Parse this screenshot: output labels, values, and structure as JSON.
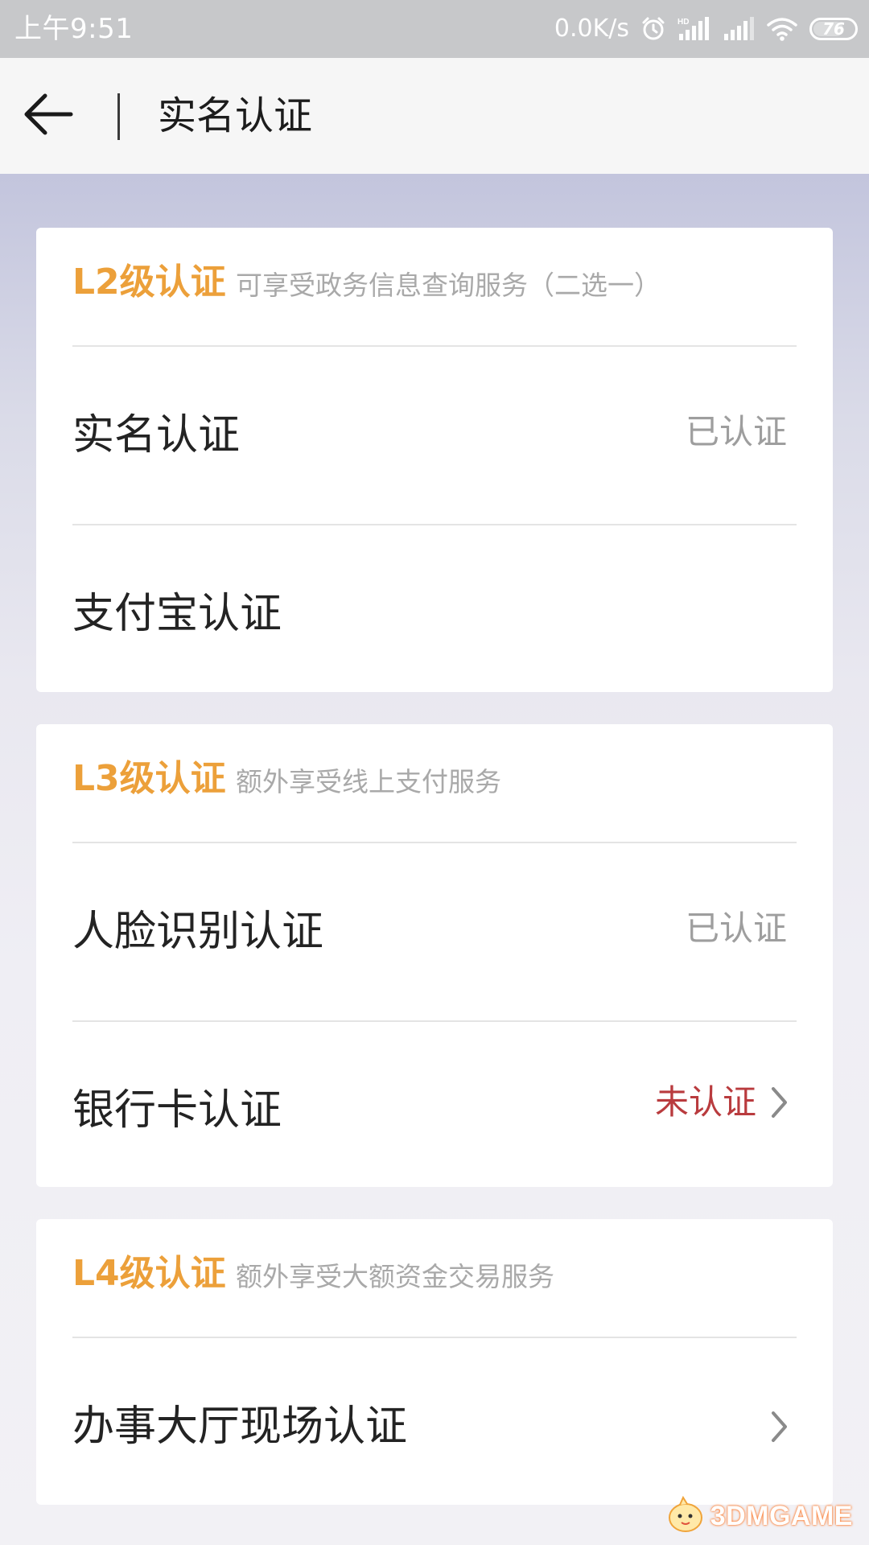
{
  "status_bar": {
    "time": "上午9:51",
    "net_speed": "0.0K/s",
    "battery": "76"
  },
  "app_bar": {
    "title": "实名认证"
  },
  "sections": [
    {
      "level": "L2级认证",
      "desc": "可享受政务信息查询服务（二选一）",
      "items": [
        {
          "label": "实名认证",
          "status": "已认证"
        },
        {
          "label": "支付宝认证",
          "status": ""
        }
      ]
    },
    {
      "level": "L3级认证",
      "desc": "额外享受线上支付服务",
      "items": [
        {
          "label": "人脸识别认证",
          "status": "已认证"
        },
        {
          "label": "银行卡认证",
          "status": "未认证"
        }
      ]
    },
    {
      "level": "L4级认证",
      "desc": "额外享受大额资金交易服务",
      "items": [
        {
          "label": "办事大厅现场认证",
          "status": ""
        }
      ]
    }
  ],
  "watermark": {
    "text": "3DMGAME"
  },
  "colors": {
    "level_accent": "#eca03a",
    "unverified": "#b93b3e",
    "verified": "#9e9e9e"
  },
  "icons": {
    "back": "arrow-left-icon",
    "chevron": "chevron-right-icon",
    "alarm": "alarm-icon",
    "signal": "signal-icon",
    "wifi": "wifi-icon",
    "battery": "battery-icon"
  }
}
